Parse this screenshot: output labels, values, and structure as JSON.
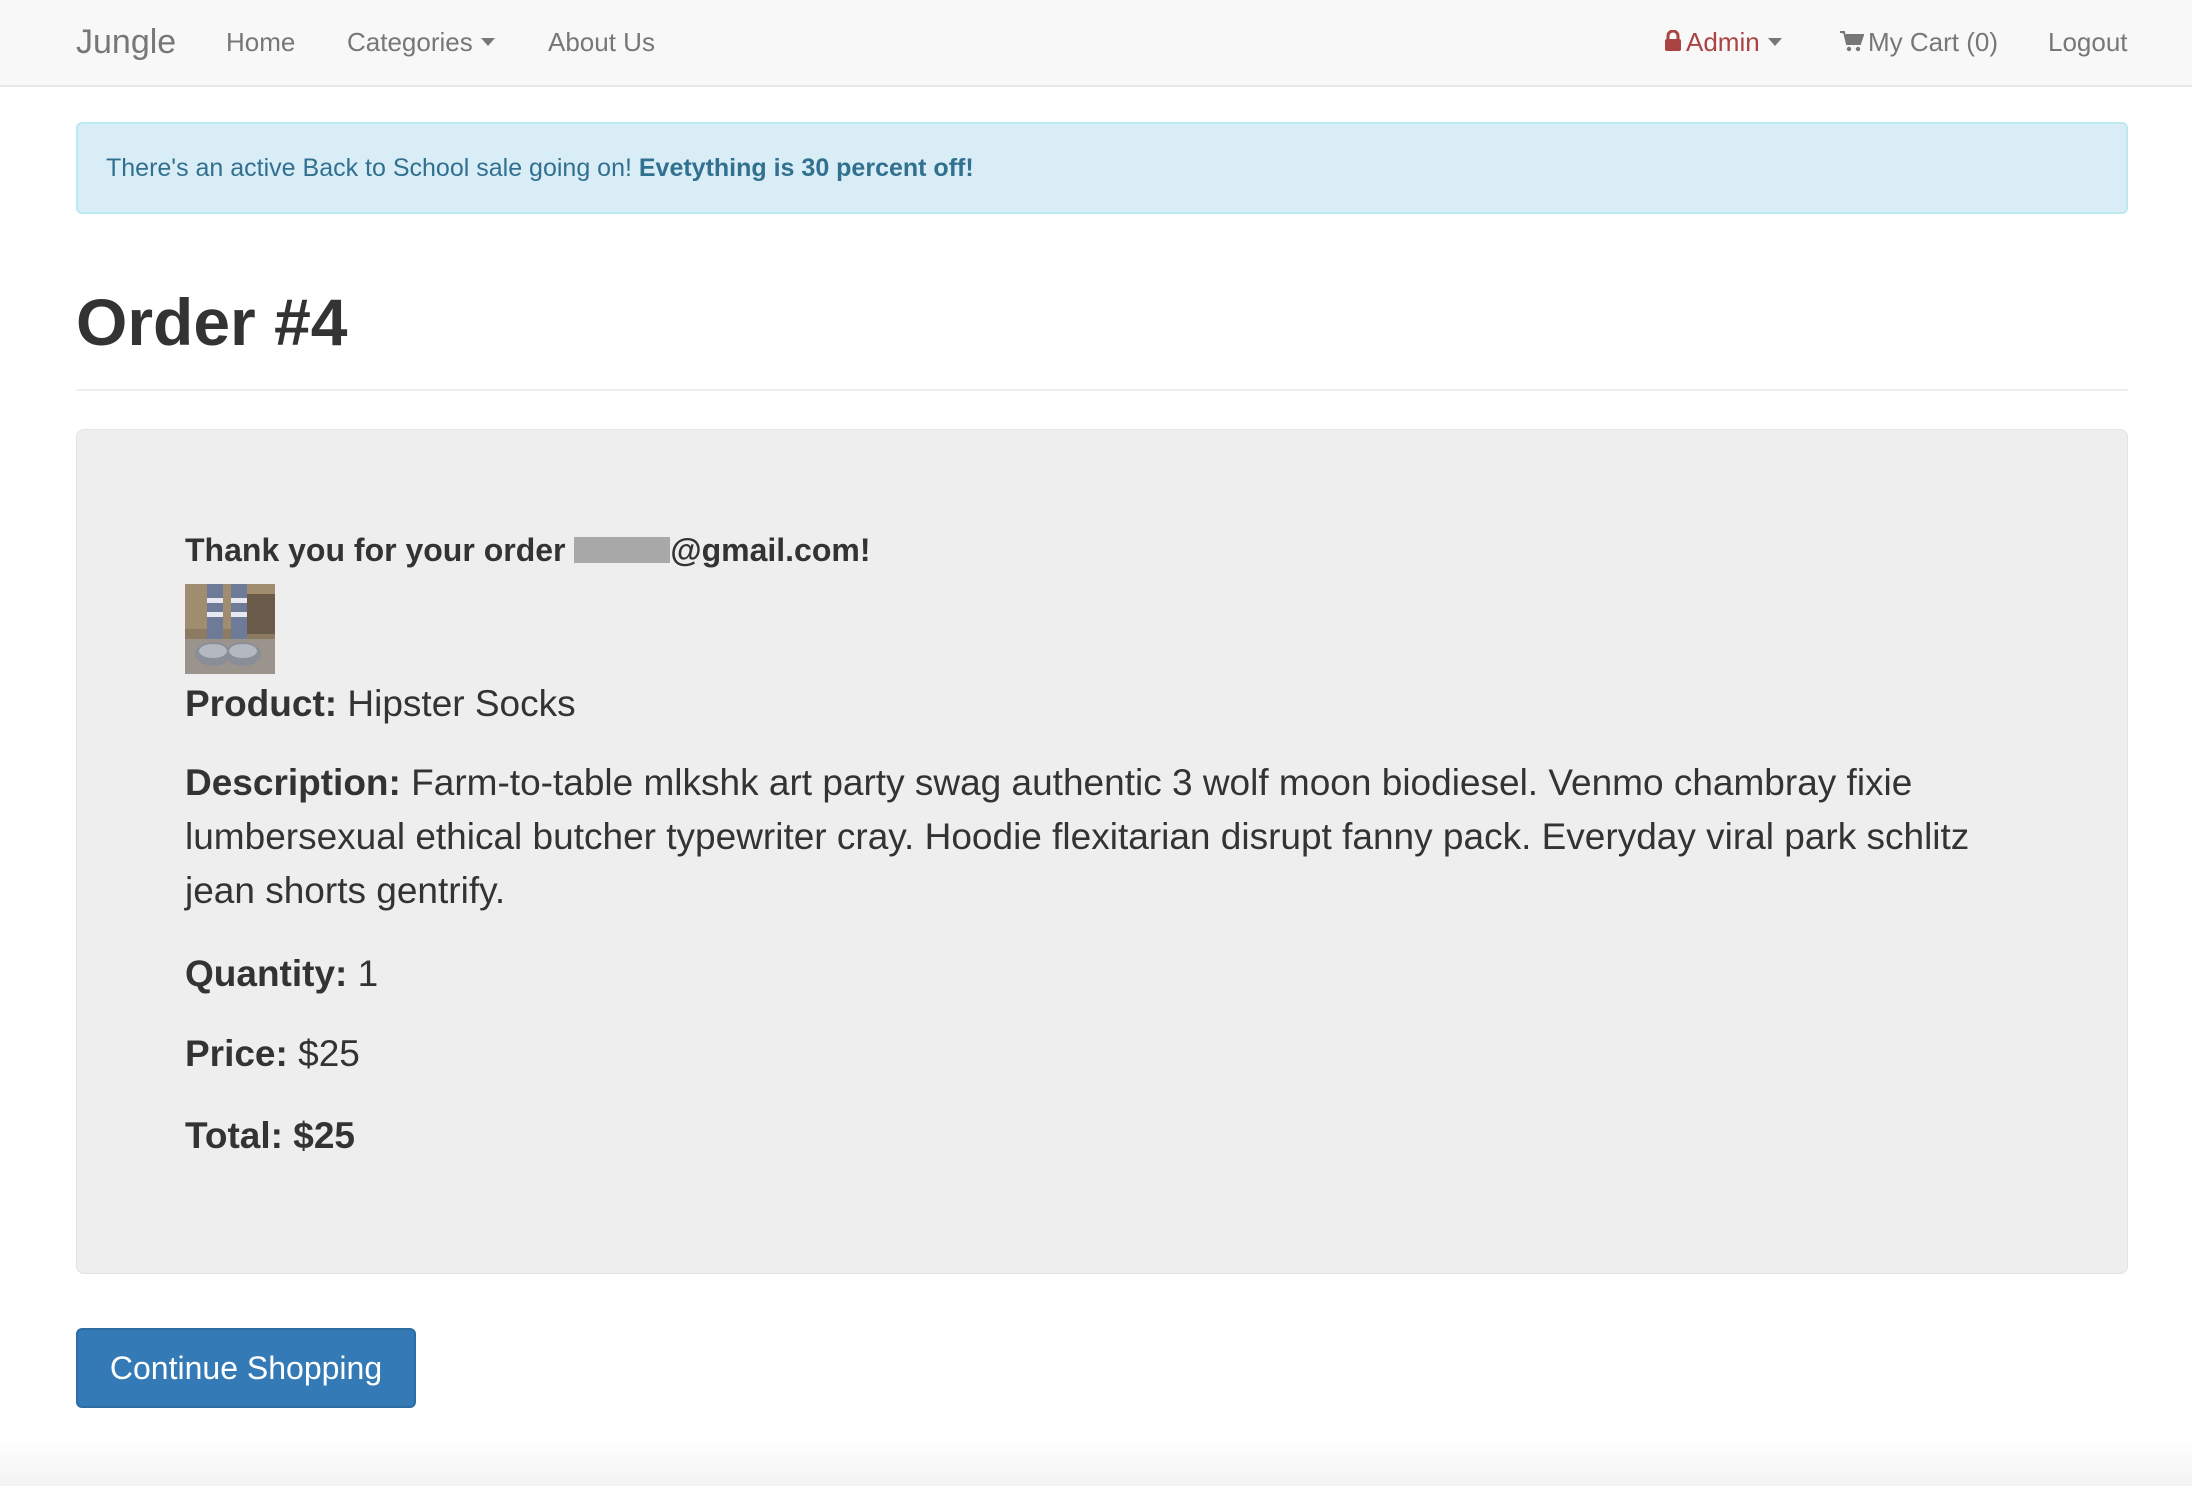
{
  "navbar": {
    "brand": "Jungle",
    "links": {
      "home": "Home",
      "categories": "Categories",
      "about": "About Us",
      "admin": "Admin",
      "cart": "My Cart (0)",
      "logout": "Logout"
    }
  },
  "alert": {
    "text": "There's an active Back to School sale going on!",
    "bold": "Evetything is 30 percent off!"
  },
  "page": {
    "title": "Order #4"
  },
  "order": {
    "thanks_prefix": "Thank you for your order",
    "email_suffix": "@gmail.com!",
    "product_label": "Product:",
    "product_value": "Hipster Socks",
    "description_label": "Description:",
    "description_value": "Farm-to-table mlkshk art party swag authentic 3 wolf moon biodiesel. Venmo chambray fixie lumbersexual ethical butcher typewriter cray. Hoodie flexitarian disrupt fanny pack. Everyday viral park schlitz jean shorts gentrify.",
    "quantity_label": "Quantity:",
    "quantity_value": "1",
    "price_label": "Price:",
    "price_value": "$25",
    "total_label": "Total:",
    "total_value": "$25"
  },
  "actions": {
    "continue": "Continue Shopping"
  },
  "colors": {
    "primary": "#337ab7",
    "alert_bg": "#d9edf7",
    "alert_text": "#31708f",
    "admin": "#a94442",
    "well": "#eeeeee"
  },
  "icons": {
    "admin": "lock-icon",
    "cart": "cart-icon"
  }
}
